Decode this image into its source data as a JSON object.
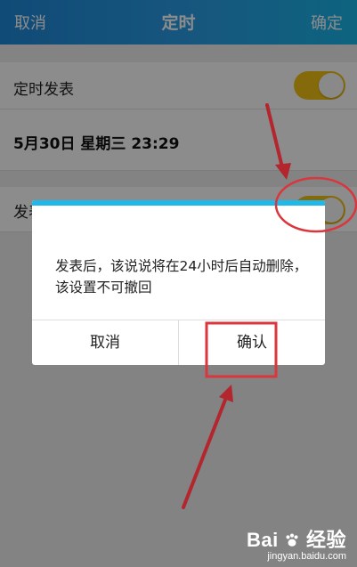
{
  "header": {
    "cancel_label": "取消",
    "title": "定时",
    "confirm_label": "确定"
  },
  "settings": {
    "scheduled_post_label": "定时发表",
    "scheduled_datetime": "5月30日 星期三 23:29",
    "auto_delete_label_visible": "发表"
  },
  "dialog": {
    "message": "发表后，该说说将在24小时后自动删除，该设置不可撤回",
    "cancel_label": "取消",
    "confirm_label": "确认"
  },
  "watermark": {
    "brand": "Bai",
    "brand_suffix": "经验",
    "sub": "jingyan.baidu.com"
  },
  "colors": {
    "header_start": "#1e88d8",
    "header_end": "#19b6e8",
    "toggle_on": "#f3c217",
    "dialog_accent": "#1fb8e8",
    "annotation_red": "#d9363e"
  },
  "icons": [
    "baidu-paw-icon"
  ]
}
